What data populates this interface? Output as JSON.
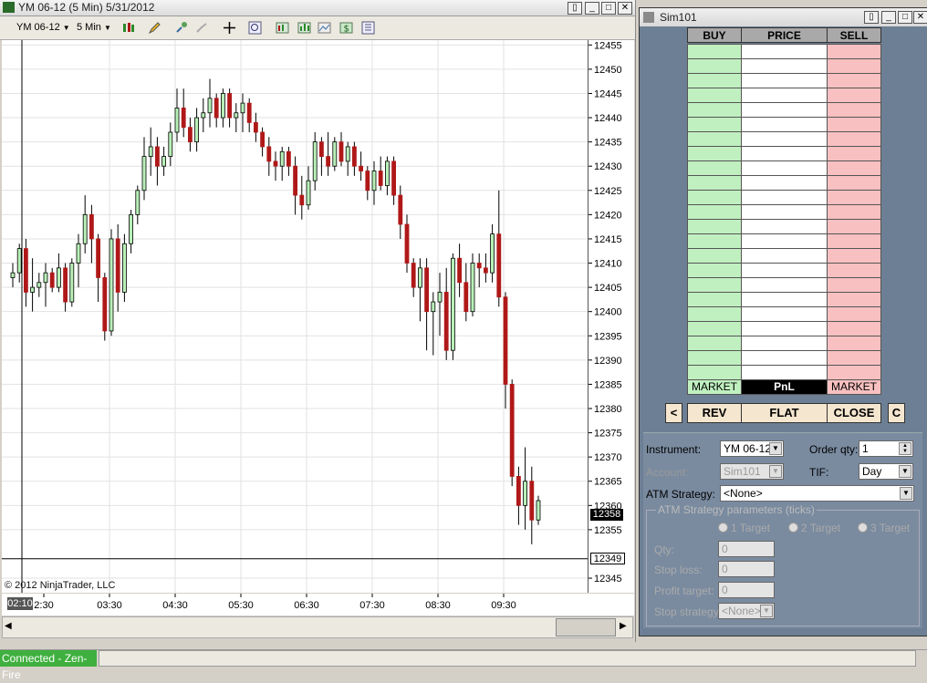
{
  "chart_window": {
    "title": "YM 06-12 (5 Min)  5/31/2012",
    "instrument_dd": "YM 06-12",
    "interval_dd": "5 Min",
    "copyright": "© 2012 NinjaTrader, LLC",
    "current_price_label": "12358",
    "crosshair_price_label": "12349",
    "crosshair_time_label": "02:10"
  },
  "chart_data": {
    "type": "candlestick",
    "title": "YM 06-12 (5 Min)  5/31/2012",
    "y_ticks": [
      12455,
      12450,
      12445,
      12440,
      12435,
      12430,
      12425,
      12420,
      12415,
      12410,
      12405,
      12400,
      12395,
      12390,
      12385,
      12380,
      12375,
      12370,
      12365,
      12360,
      12355,
      12345
    ],
    "x_ticks": [
      "2:30",
      "03:30",
      "04:30",
      "05:30",
      "06:30",
      "07:30",
      "08:30",
      "09:30"
    ],
    "ylim": [
      12342,
      12456
    ],
    "grid": true,
    "colors": {
      "up": "#b8f0b8",
      "down": "#b01818"
    },
    "ohlc": [
      [
        12407,
        12410,
        12405,
        12408
      ],
      [
        12408,
        12414,
        12406,
        12413
      ],
      [
        12413,
        12415,
        12401,
        12404
      ],
      [
        12404,
        12411,
        12400,
        12405
      ],
      [
        12405,
        12408,
        12403,
        12406
      ],
      [
        12406,
        12410,
        12401,
        12408
      ],
      [
        12408,
        12409,
        12404,
        12405
      ],
      [
        12405,
        12412,
        12404,
        12409
      ],
      [
        12409,
        12410,
        12400,
        12402
      ],
      [
        12402,
        12411,
        12401,
        12410
      ],
      [
        12410,
        12416,
        12405,
        12414
      ],
      [
        12414,
        12424,
        12412,
        12420
      ],
      [
        12420,
        12422,
        12410,
        12415
      ],
      [
        12415,
        12416,
        12402,
        12407
      ],
      [
        12407,
        12408,
        12394,
        12396
      ],
      [
        12396,
        12417,
        12395,
        12415
      ],
      [
        12415,
        12418,
        12400,
        12404
      ],
      [
        12404,
        12416,
        12402,
        12414
      ],
      [
        12414,
        12421,
        12412,
        12420
      ],
      [
        12420,
        12426,
        12418,
        12425
      ],
      [
        12425,
        12436,
        12423,
        12432
      ],
      [
        12432,
        12438,
        12428,
        12434
      ],
      [
        12434,
        12436,
        12426,
        12430
      ],
      [
        12430,
        12434,
        12428,
        12432
      ],
      [
        12432,
        12439,
        12430,
        12437
      ],
      [
        12437,
        12446,
        12435,
        12442
      ],
      [
        12442,
        12446,
        12436,
        12438
      ],
      [
        12438,
        12440,
        12433,
        12435
      ],
      [
        12435,
        12442,
        12433,
        12440
      ],
      [
        12440,
        12444,
        12437,
        12441
      ],
      [
        12441,
        12448,
        12438,
        12444
      ],
      [
        12444,
        12445,
        12438,
        12440
      ],
      [
        12440,
        12446,
        12438,
        12445
      ],
      [
        12445,
        12446,
        12438,
        12440
      ],
      [
        12440,
        12443,
        12437,
        12441
      ],
      [
        12441,
        12445,
        12437,
        12443
      ],
      [
        12443,
        12444,
        12437,
        12439
      ],
      [
        12439,
        12441,
        12435,
        12437
      ],
      [
        12437,
        12438,
        12432,
        12434
      ],
      [
        12434,
        12436,
        12428,
        12431
      ],
      [
        12431,
        12433,
        12427,
        12430
      ],
      [
        12430,
        12434,
        12427,
        12433
      ],
      [
        12433,
        12434,
        12428,
        12430
      ],
      [
        12430,
        12432,
        12420,
        12424
      ],
      [
        12424,
        12428,
        12419,
        12422
      ],
      [
        12422,
        12430,
        12421,
        12427
      ],
      [
        12427,
        12437,
        12425,
        12435
      ],
      [
        12435,
        12436,
        12428,
        12432
      ],
      [
        12432,
        12437,
        12428,
        12430
      ],
      [
        12430,
        12436,
        12429,
        12435
      ],
      [
        12435,
        12437,
        12430,
        12431
      ],
      [
        12431,
        12435,
        12428,
        12434
      ],
      [
        12434,
        12435,
        12428,
        12430
      ],
      [
        12430,
        12433,
        12427,
        12429
      ],
      [
        12429,
        12430,
        12423,
        12425
      ],
      [
        12425,
        12431,
        12422,
        12429
      ],
      [
        12429,
        12432,
        12425,
        12426
      ],
      [
        12426,
        12432,
        12424,
        12431
      ],
      [
        12431,
        12432,
        12422,
        12424
      ],
      [
        12424,
        12426,
        12415,
        12418
      ],
      [
        12418,
        12420,
        12408,
        12410
      ],
      [
        12410,
        12411,
        12403,
        12405
      ],
      [
        12405,
        12411,
        12398,
        12409
      ],
      [
        12409,
        12411,
        12392,
        12400
      ],
      [
        12400,
        12404,
        12391,
        12402
      ],
      [
        12402,
        12408,
        12395,
        12404
      ],
      [
        12404,
        12409,
        12390,
        12392
      ],
      [
        12392,
        12412,
        12390,
        12411
      ],
      [
        12411,
        12414,
        12403,
        12406
      ],
      [
        12406,
        12410,
        12398,
        12400
      ],
      [
        12400,
        12412,
        12399,
        12410
      ],
      [
        12410,
        12412,
        12405,
        12409
      ],
      [
        12409,
        12412,
        12406,
        12408
      ],
      [
        12408,
        12418,
        12406,
        12416
      ],
      [
        12416,
        12425,
        12401,
        12403
      ],
      [
        12403,
        12404,
        12380,
        12385
      ],
      [
        12385,
        12386,
        12364,
        12366
      ],
      [
        12366,
        12368,
        12356,
        12360
      ],
      [
        12360,
        12372,
        12355,
        12365
      ],
      [
        12365,
        12368,
        12352,
        12357
      ],
      [
        12357,
        12362,
        12356,
        12361
      ]
    ]
  },
  "sim_window": {
    "title": "Sim101",
    "ladder": {
      "headers": {
        "buy": "BUY",
        "price": "PRICE",
        "sell": "SELL"
      },
      "footer": {
        "buy": "MARKET",
        "price": "PnL",
        "sell": "MARKET"
      },
      "rows": 24
    },
    "buttons": {
      "left": "<",
      "rev": "REV",
      "flat": "FLAT",
      "close": "CLOSE",
      "c": "C"
    },
    "form": {
      "instrument_label": "Instrument:",
      "instrument_value": "YM 06-12",
      "order_qty_label": "Order qty:",
      "order_qty_value": "1",
      "account_label": "Account:",
      "account_value": "Sim101",
      "tif_label": "TIF:",
      "tif_value": "Day",
      "atm_label": "ATM Strategy:",
      "atm_value": "<None>",
      "atm_params_label": "ATM Strategy parameters (ticks)",
      "target1": "1 Target",
      "target2": "2 Target",
      "target3": "3 Target",
      "qty_label": "Qty:",
      "qty_value": "0",
      "stop_loss_label": "Stop loss:",
      "stop_loss_value": "0",
      "profit_target_label": "Profit target:",
      "profit_target_value": "0",
      "stop_strategy_label": "Stop strategy:",
      "stop_strategy_value": "<None>"
    }
  },
  "status": {
    "connection": "Connected - Zen-Fire"
  }
}
